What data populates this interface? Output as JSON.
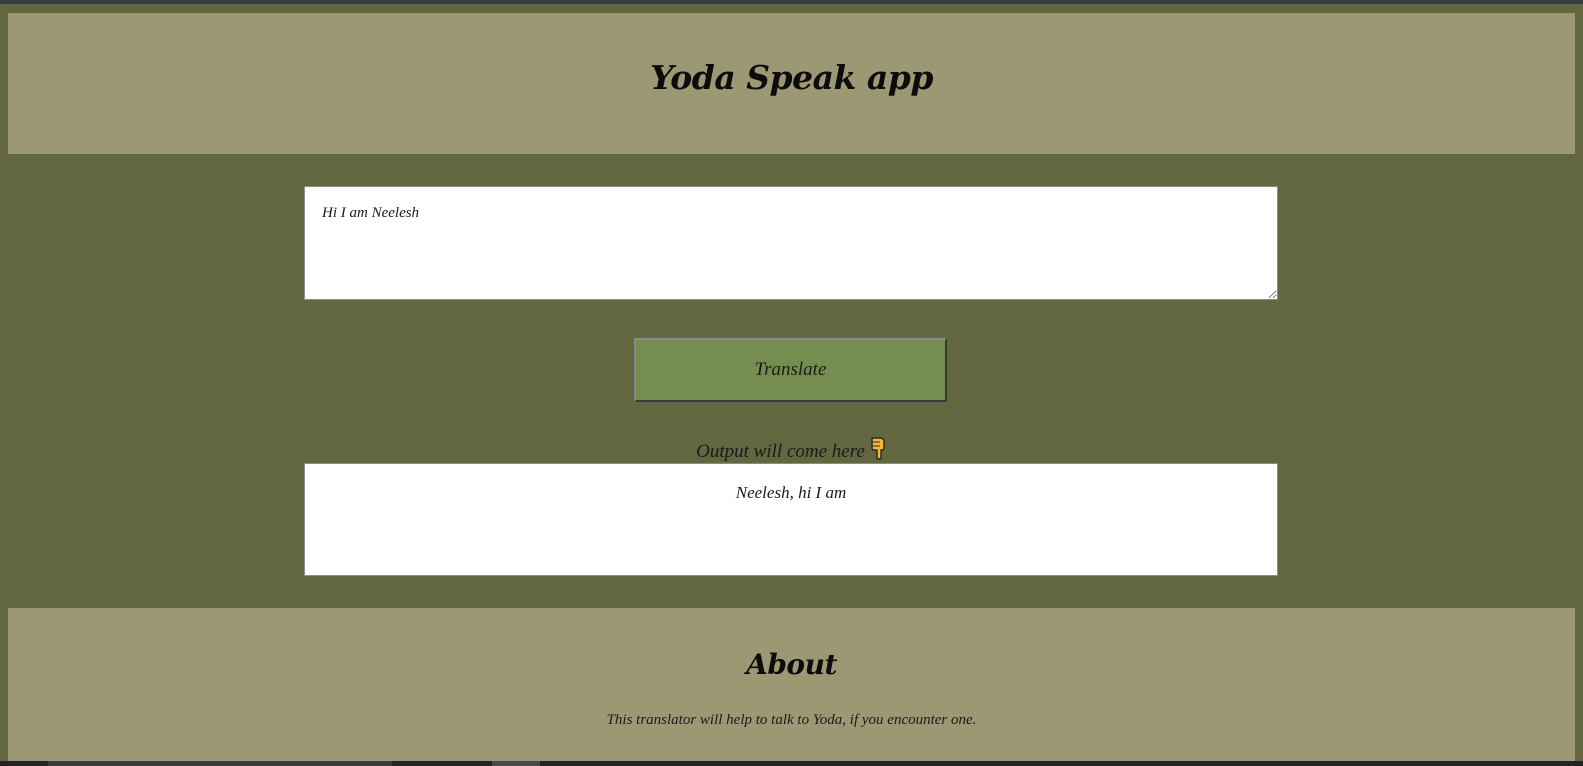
{
  "header": {
    "title": "Yoda Speak app"
  },
  "input": {
    "value": "Hi I am Neelesh"
  },
  "translate_button": {
    "label": "Translate"
  },
  "output": {
    "label": "Output will come here",
    "label_icon": "pointing-down-hand-icon",
    "text": "Neelesh, hi I am"
  },
  "about": {
    "heading": "About",
    "text": "This translator will help to talk to Yoda, if you encounter one."
  },
  "colors": {
    "page_background": "#63673f",
    "banner_background": "#9d9874",
    "button_background": "#758e4f",
    "box_background": "#ffffff"
  }
}
